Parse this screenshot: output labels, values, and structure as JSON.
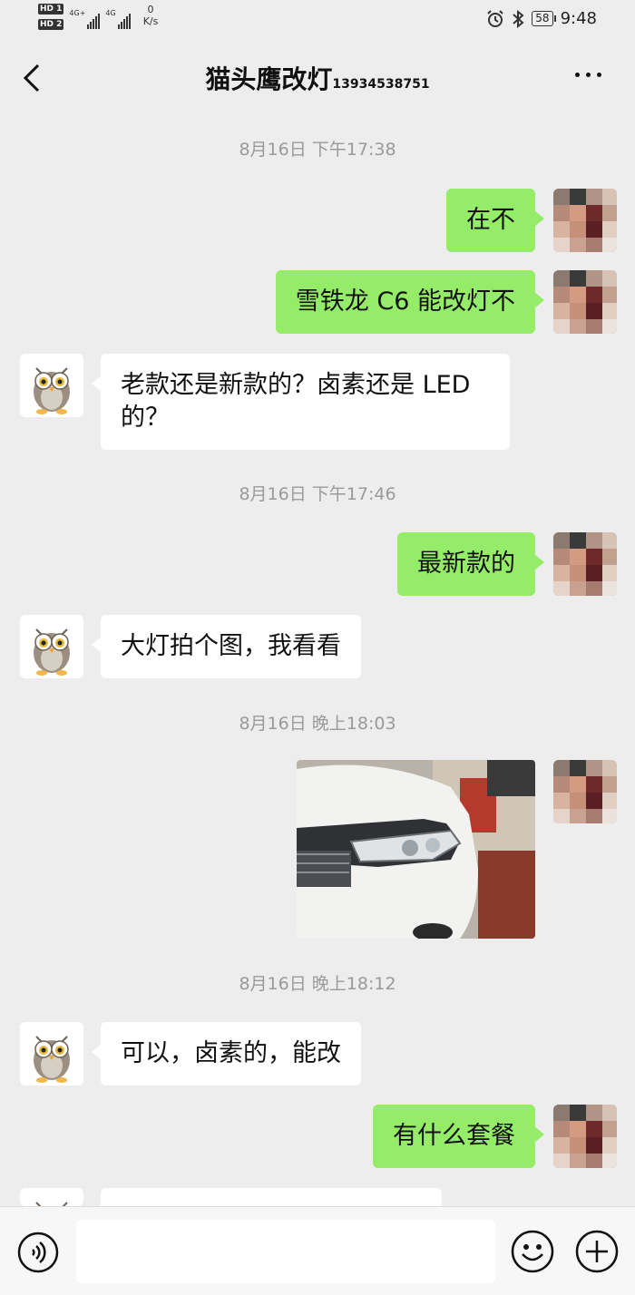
{
  "status_bar": {
    "sim1": "HD 1",
    "sim2": "HD 2",
    "net1": "4G+",
    "net2": "4G",
    "speed_value": "0",
    "speed_unit": "K/s",
    "battery": "58",
    "time": "9:48",
    "icons": [
      "alarm-icon",
      "bluetooth-icon",
      "battery-icon"
    ]
  },
  "header": {
    "title": "猫头鹰改灯",
    "phone": "13934538751",
    "back_icon": "back-chevron-icon",
    "more_icon": "more-dots-icon"
  },
  "messages": [
    {
      "type": "timestamp",
      "text": "8月16日 下午17:38"
    },
    {
      "type": "sent",
      "text": "在不"
    },
    {
      "type": "sent",
      "text": "雪铁龙 C6 能改灯不"
    },
    {
      "type": "received",
      "text": "老款还是新款的？卤素还是 LED 的？"
    },
    {
      "type": "timestamp",
      "text": "8月16日 下午17:46"
    },
    {
      "type": "sent",
      "text": "最新款的"
    },
    {
      "type": "received",
      "text": "大灯拍个图，我看看"
    },
    {
      "type": "timestamp",
      "text": "8月16日 晚上18:03"
    },
    {
      "type": "sent_image",
      "text": ""
    },
    {
      "type": "timestamp",
      "text": "8月16日 晚上18:12"
    },
    {
      "type": "received",
      "text": "可以，卤素的，能改"
    },
    {
      "type": "sent",
      "text": "有什么套餐"
    }
  ],
  "input_bar": {
    "placeholder": "",
    "icons": [
      "voice-icon",
      "emoji-icon",
      "plus-icon"
    ]
  },
  "colors": {
    "background": "#ededed",
    "sent_bubble": "#95ec69",
    "received_bubble": "#ffffff",
    "timestamp": "#9a9a9a"
  }
}
